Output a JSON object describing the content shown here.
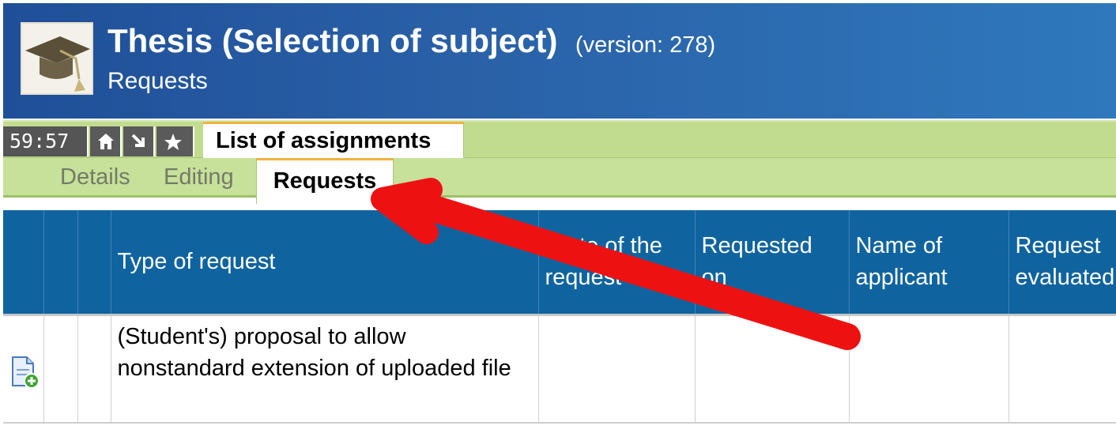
{
  "header": {
    "title": "Thesis (Selection of subject)",
    "version": "(version: 278)",
    "subtitle": "Requests",
    "logo_icon": "graduation-cap-icon"
  },
  "toolbar": {
    "timer": "59:57",
    "buttons": [
      {
        "icon": "home-icon"
      },
      {
        "icon": "arrow-down-right-icon"
      },
      {
        "icon": "star-icon"
      }
    ],
    "main_tab": "List of assignments"
  },
  "subtabs": {
    "items": [
      "Details",
      "Editing"
    ],
    "active": "Requests"
  },
  "table": {
    "columns": [
      "",
      "",
      "",
      "Type of request",
      "State of the request",
      "Requested on",
      "Name of applicant",
      "Request evaluated"
    ],
    "rows": [
      {
        "icon": "add-document-icon",
        "type": "(Student's) proposal to allow nonstandard extension of uploaded file",
        "state": "",
        "requested_on": "",
        "applicant": "",
        "evaluated": ""
      }
    ]
  },
  "colors": {
    "header_blue": "#2a62a8",
    "table_header_blue": "#0f64a0",
    "toolbar_green": "#c1dc8e",
    "tab_accent_orange": "#f2b141",
    "annotation_red": "#ee1111"
  }
}
